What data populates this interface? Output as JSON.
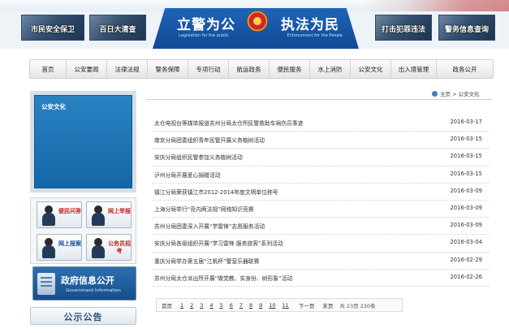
{
  "banner": {
    "left_photos": [
      "市民安全保卫",
      "百日大清查"
    ],
    "right_photos": [
      "打击犯罪违法",
      "警务信息查询"
    ],
    "slogan_left": "立警为公",
    "slogan_left_en": "Legislation for the public",
    "slogan_right": "执法为民",
    "slogan_right_en": "Enforcement for the People"
  },
  "nav": {
    "items": [
      "首页",
      "公安要闻",
      "法律法规",
      "警务保障",
      "专项行动",
      "航运政务",
      "便民服务",
      "水上消防",
      "公安文化",
      "出入境管理",
      "政务公开"
    ]
  },
  "sidebar": {
    "section_title": "公安文化",
    "services": [
      {
        "label": "便民问答"
      },
      {
        "label": "网上举报"
      },
      {
        "label": "网上报案"
      },
      {
        "label": "公务员招考"
      }
    ],
    "gov_title": "政府信息公开",
    "gov_subtitle": "Government Information",
    "notice_title": "公示公告"
  },
  "breadcrumb": {
    "home": "主页",
    "sep": ">",
    "current": "公安文化"
  },
  "news": [
    {
      "title": "太仓电视台等媒体报道苏州分局太仓所民警救助车祸伤员事迹",
      "date": "2016-03-17"
    },
    {
      "title": "南京分局团委组织青年民警开展义务植树活动",
      "date": "2016-03-15"
    },
    {
      "title": "安庆分局组织民警参加义务植树活动",
      "date": "2016-03-15"
    },
    {
      "title": "泸州分局开展爱心捐赠活动",
      "date": "2016-03-15"
    },
    {
      "title": "镇江分局荣获镇江市2012-2014年度文明单位称号",
      "date": "2016-03-09"
    },
    {
      "title": "上海分局举行“竞内两法规”网络知识竞赛",
      "date": "2016-03-09"
    },
    {
      "title": "苏州分局团委深入开展“学雷锋”志愿服务活动",
      "date": "2016-03-09"
    },
    {
      "title": "安庆分局各级组织开展“学习雷锋 服务旅客”系列活动",
      "date": "2016-03-04"
    },
    {
      "title": "重庆分局举办第五届“江帆杯”警营乐器联赛",
      "date": "2016-02-29"
    },
    {
      "title": "苏州分局太仓派出所开展“做党教、实身份、树形象”活动",
      "date": "2016-02-26"
    }
  ],
  "pager": {
    "first": "首页",
    "pages": [
      "1",
      "2",
      "3",
      "4",
      "5",
      "6",
      "7",
      "8",
      "9",
      "10",
      "11"
    ],
    "next": "下一页",
    "last": "末页",
    "info": "共 23页 230条"
  }
}
